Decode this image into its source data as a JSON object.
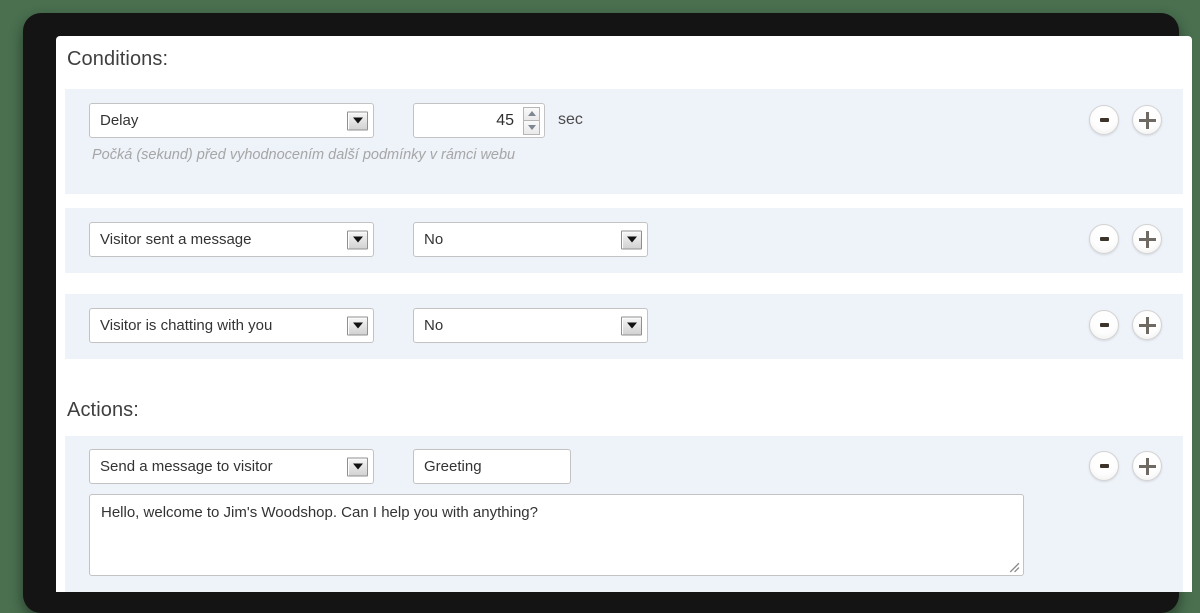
{
  "panel": {
    "conditions_title": "Conditions:",
    "actions_title": "Actions:"
  },
  "conditions": [
    {
      "type_label": "Delay",
      "value": "45",
      "unit": "sec",
      "hint": "Počká (sekund) před vyhodnocením další podmínky v rámci webu",
      "remove_label": "-",
      "add_label": "+"
    },
    {
      "type_label": "Visitor sent a message",
      "value_label": "No",
      "remove_label": "-",
      "add_label": "+"
    },
    {
      "type_label": "Visitor is chatting with you",
      "value_label": "No",
      "remove_label": "-",
      "add_label": "+"
    }
  ],
  "actions": [
    {
      "type_label": "Send a message to visitor",
      "name_value": "Greeting",
      "message_value": "Hello, welcome to Jim's Woodshop. Can I help you with anything?",
      "remove_label": "-",
      "add_label": "+"
    }
  ],
  "colors": {
    "row_background": "#eef2f9",
    "card_background": "#ffffff",
    "frame": "#141414",
    "page_background": "#4a7050",
    "hint_text": "#a6a6a6"
  }
}
